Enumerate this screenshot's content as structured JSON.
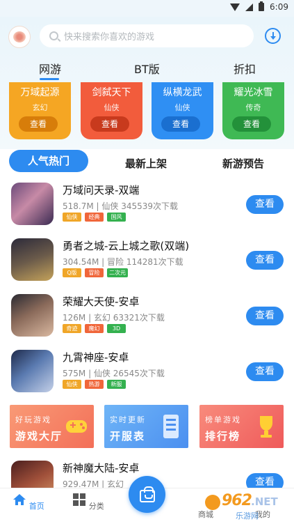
{
  "status_bar": {
    "time": "6:09"
  },
  "search": {
    "placeholder": "快来搜索你喜欢的游戏"
  },
  "top_tabs": [
    "网游",
    "BT版",
    "折扣"
  ],
  "categories": [
    {
      "title": "万域起源",
      "sub": "玄幻",
      "button": "查看",
      "color": "#f5a623",
      "btn_color": "#d77d0a"
    },
    {
      "title": "剑弑天下",
      "sub": "仙侠",
      "button": "查看",
      "color": "#f25c3c",
      "btn_color": "#c83a1d"
    },
    {
      "title": "纵横龙武",
      "sub": "仙侠",
      "button": "查看",
      "color": "#2f8ff3",
      "btn_color": "#1a6fd0"
    },
    {
      "title": "耀光冰雪",
      "sub": "传奇",
      "button": "查看",
      "color": "#3fb954",
      "btn_color": "#23913a"
    }
  ],
  "list_tabs": {
    "active": "人气热门",
    "tab2": "最新上架",
    "tab3": "新游预告"
  },
  "games": [
    {
      "name": "万域问天录-双端",
      "meta": "518.7M | 仙侠   345539次下载",
      "tags": [
        [
          "仙侠",
          "#f0a628"
        ],
        [
          "经典",
          "#f0663a"
        ],
        [
          "国风",
          "#34b14f"
        ]
      ],
      "button": "查看"
    },
    {
      "name": "勇者之城-云上城之歌(双端)",
      "meta": "304.54M | 冒险   114281次下载",
      "tags": [
        [
          "Q版",
          "#f0a628"
        ],
        [
          "冒险",
          "#f0663a"
        ],
        [
          "二次元",
          "#34b14f"
        ]
      ],
      "button": "查看"
    },
    {
      "name": "荣耀大天使-安卓",
      "meta": "126M | 玄幻   63321次下载",
      "tags": [
        [
          "奇迹",
          "#f0a628"
        ],
        [
          "魔幻",
          "#f0663a"
        ],
        [
          "3D",
          "#34b14f"
        ]
      ],
      "button": "查看"
    },
    {
      "name": "九霄神座-安卓",
      "meta": "575M | 仙侠   26545次下载",
      "tags": [
        [
          "仙侠",
          "#f0a628"
        ],
        [
          "热游",
          "#f0663a"
        ],
        [
          "新服",
          "#34b14f"
        ]
      ],
      "button": "查看"
    },
    {
      "name": "新神魔大陆-安卓",
      "meta": "929.47M | 玄幻",
      "tags": [],
      "button": "查看"
    }
  ],
  "banners": [
    {
      "small": "好玩游戏",
      "big": "游戏大厅",
      "color": "#f7856a",
      "icon": "gamepad-icon"
    },
    {
      "small": "实时更新",
      "big": "开服表",
      "color": "#5aa4f3",
      "icon": "phone-list-icon"
    },
    {
      "small": "榜单游戏",
      "big": "排行榜",
      "color": "#f36b6b",
      "icon": "trophy-icon"
    }
  ],
  "bottom_nav": {
    "home": "首页",
    "category": "分类",
    "mall": "商城",
    "mine": "我的"
  },
  "colors": {
    "accent": "#2d8bf0"
  },
  "watermark": {
    "num": "962",
    "suffix": ".NET",
    "sub": "乐游网"
  }
}
